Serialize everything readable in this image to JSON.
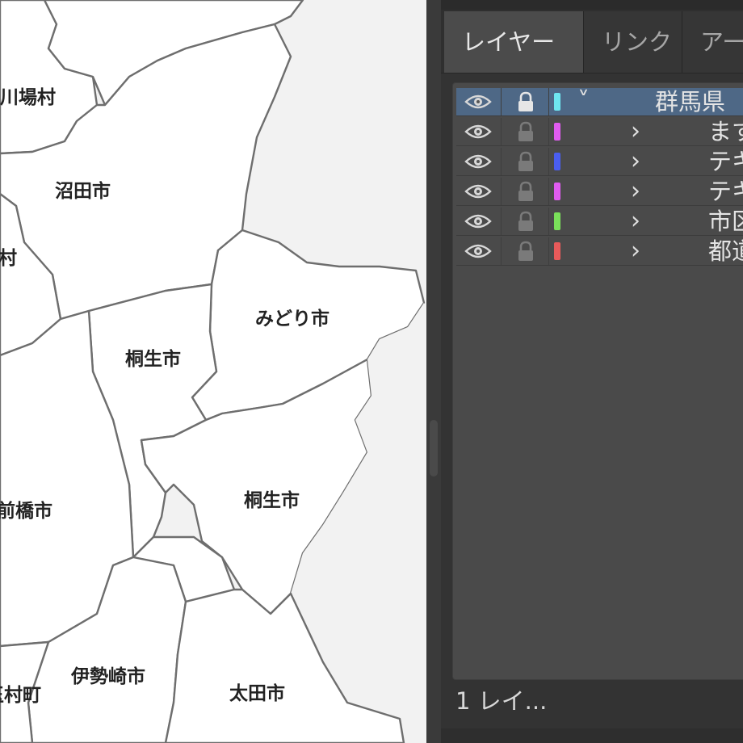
{
  "map": {
    "labels": {
      "kawaba": "川場村",
      "numata": "沼田市",
      "mura": "村",
      "midori": "みどり市",
      "kiryu_1": "桐生市",
      "kiryu_2": "桐生市",
      "maebashi": "前橋市",
      "isesaki": "伊勢崎市",
      "tamamura": "玉村町",
      "ota": "太田市"
    }
  },
  "panel": {
    "tabs": [
      "レイヤー",
      "リンク",
      "アートボード"
    ],
    "active_tab": "レイヤー",
    "layers": [
      {
        "name": "群馬県",
        "color": "#6ee6f0",
        "expanded": true,
        "selected": true,
        "level": 0
      },
      {
        "name": "ますめ",
        "color": "#e05cf0",
        "expanded": false,
        "selected": false,
        "level": 1
      },
      {
        "name": "テキスト",
        "color": "#4a5ef0",
        "expanded": false,
        "selected": false,
        "level": 1
      },
      {
        "name": "テキスト",
        "color": "#e05cf0",
        "expanded": false,
        "selected": false,
        "level": 1
      },
      {
        "name": "市区町村",
        "color": "#7ae05a",
        "expanded": false,
        "selected": false,
        "level": 1
      },
      {
        "name": "都道府県",
        "color": "#e85a5a",
        "expanded": false,
        "selected": false,
        "level": 1
      }
    ],
    "footer": "1 レイ..."
  },
  "icons": {
    "visibility": "eye-icon",
    "lock": "lock-icon",
    "expand": "chevron-down-icon",
    "collapse": "chevron-right-icon"
  }
}
